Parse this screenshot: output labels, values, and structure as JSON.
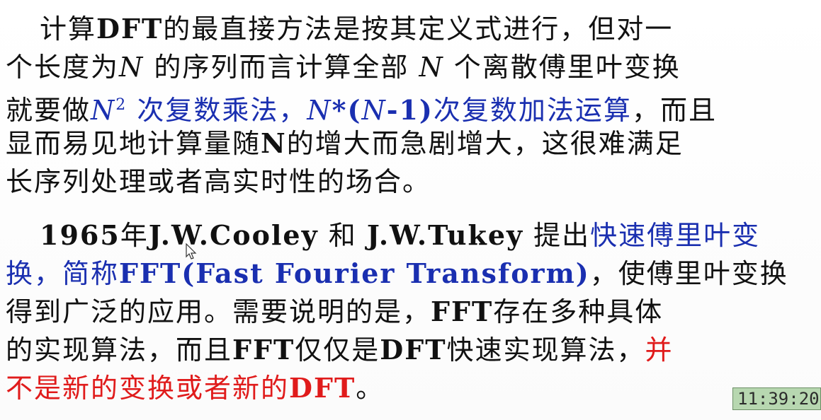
{
  "paragraph1": {
    "l1_a": "计算",
    "l1_b": "DFT",
    "l1_c": "的最直接方法是按其定义式进行，但对一",
    "l2_a": "个长度为",
    "l2_b": "N",
    "l2_c": " 的序列而言计算全部 ",
    "l2_d": "N",
    "l2_e": " 个离散傅里叶变换",
    "l3_a": "就要做",
    "l3_b": "N",
    "l3_b_sup": "2",
    "l3_c": " 次复数乘法，",
    "l3_d": "N",
    "l3_e": "*(",
    "l3_f": "N",
    "l3_g": "-1)",
    "l3_h": "次复数加法运算",
    "l3_i": "，而且",
    "l4_a": "显而易见地计算量随",
    "l4_b": "N",
    "l4_c": "的增大而急剧增大，这很难满足",
    "l5": "长序列处理或者高实时性的场合。"
  },
  "paragraph2": {
    "l1_a": "1965",
    "l1_b": "年",
    "l1_c": "J.W.Cooley",
    "l1_d": " 和 ",
    "l1_e": "J.W.Tukey",
    "l1_f": " 提出",
    "l1_g": "快速傅里叶变",
    "l2_a": "换，简称",
    "l2_b": "FFT(Fast Fourier Transform)",
    "l2_c": "，使傅里叶变换",
    "l3_a": "得到广泛的应用。需要说明的是，",
    "l3_b": "FFT",
    "l3_c": "存在多种具体",
    "l4_a": "的实现算法，而且",
    "l4_b": "FFT",
    "l4_c": "仅仅是",
    "l4_d": "DFT",
    "l4_e": "快速实现算法，",
    "l4_f": "并",
    "l5_a": "不是新的变换或者新的",
    "l5_b": "DFT",
    "l5_c": "。"
  },
  "overlay": {
    "timestamp": "11:39:20"
  },
  "colors": {
    "text": "#111111",
    "blue_highlight": "#1a2fb0",
    "red_highlight": "#e01b1b",
    "timestamp_bg": "#b7d7b0"
  }
}
